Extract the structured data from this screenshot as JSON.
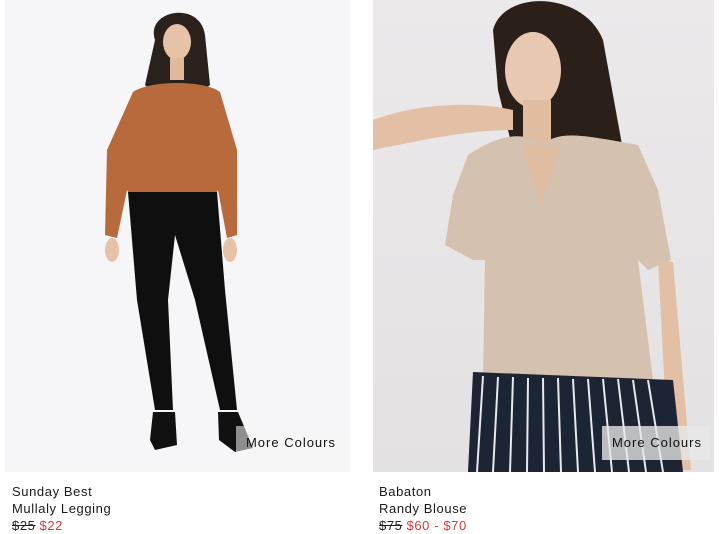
{
  "products": [
    {
      "brand": "Sunday Best",
      "name": "Mullaly Legging",
      "original_price": "$25",
      "sale_price": "$22",
      "more_colours_label": "More Colours"
    },
    {
      "brand": "Babaton",
      "name": "Randy Blouse",
      "original_price": "$75",
      "sale_price": "$60 - $70",
      "more_colours_label": "More Colours"
    }
  ],
  "colors": {
    "sale_red": "#d63a3a",
    "text_dark": "#1a1a1a"
  }
}
